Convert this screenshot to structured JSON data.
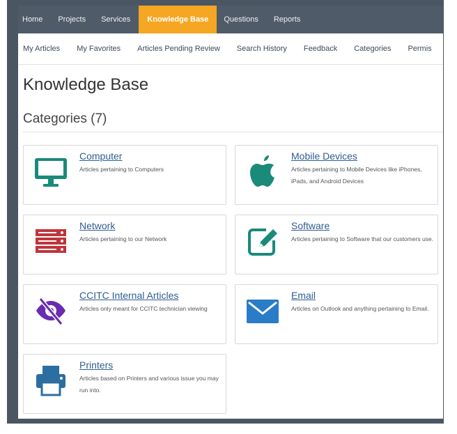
{
  "top_nav": {
    "items": [
      "Home",
      "Projects",
      "Services",
      "Knowledge Base",
      "Questions",
      "Reports"
    ],
    "active": "Knowledge Base",
    "active_color": "#f5a623",
    "background_color": "#4f5b68"
  },
  "sub_nav": {
    "items": [
      "My Articles",
      "My Favorites",
      "Articles Pending Review",
      "Search History",
      "Feedback",
      "Categories",
      "Permis"
    ]
  },
  "page": {
    "title": "Knowledge Base",
    "section_title": "Categories (7)"
  },
  "categories": [
    {
      "title": "Computer",
      "description": "Articles pertaining to Computers",
      "icon": "monitor-icon",
      "icon_color": "#1a8a7a"
    },
    {
      "title": "Mobile Devices",
      "description": "Articles pertaining to Mobile Devices like iPhones, iPads, and Android Devices",
      "icon": "apple-icon",
      "icon_color": "#1a8a7a"
    },
    {
      "title": "Network",
      "description": "Articles pertaining to our Network",
      "icon": "server-icon",
      "icon_color": "#c0343b"
    },
    {
      "title": "Software",
      "description": "Articles pertaining to Software that our customers use.",
      "icon": "edit-icon",
      "icon_color": "#1a8a7a"
    },
    {
      "title": "CCITC Internal Articles",
      "description": "Articles only meant for CCITC technician viewing",
      "icon": "eye-slash-icon",
      "icon_color": "#6a2bb0"
    },
    {
      "title": "Email",
      "description": "Articles on Outlook and anything pertaining to Email.",
      "icon": "envelope-icon",
      "icon_color": "#2a7cc7"
    },
    {
      "title": "Printers",
      "description": "Articles based on Printers and various issue you may run into.",
      "icon": "printer-icon",
      "icon_color": "#2c6ea0"
    }
  ]
}
